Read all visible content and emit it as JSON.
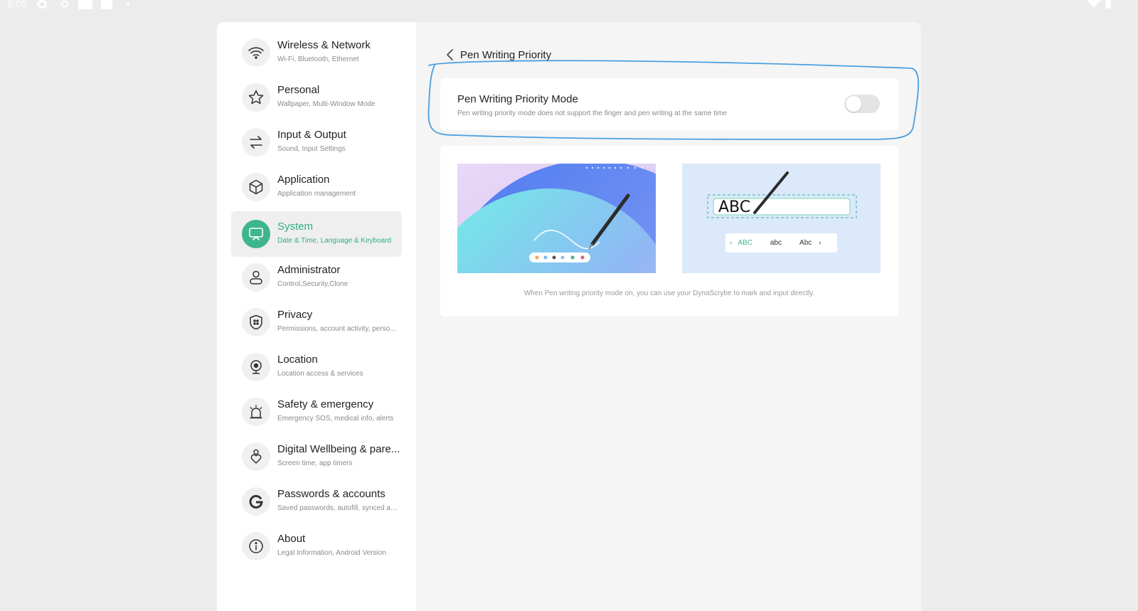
{
  "status_bar": {
    "time": "8:05"
  },
  "sidebar": {
    "items": [
      {
        "title": "Wireless & Network",
        "subtitle": "Wi-Fi, Bluetooth, Ethernet",
        "icon": "wifi-icon"
      },
      {
        "title": "Personal",
        "subtitle": "Wallpaper, Multi-Window Mode",
        "icon": "star-icon"
      },
      {
        "title": "Input & Output",
        "subtitle": "Sound, Input Settings",
        "icon": "swap-arrows-icon"
      },
      {
        "title": "Application",
        "subtitle": "Application management",
        "icon": "cube-icon"
      },
      {
        "title": "System",
        "subtitle": "Date & Time, Language & Keyboard",
        "icon": "presentation-screen-icon",
        "active": true
      },
      {
        "title": "Administrator",
        "subtitle": "Control,Security,Clone",
        "icon": "person-icon"
      },
      {
        "title": "Privacy",
        "subtitle": "Permissions, account activity, perso...",
        "icon": "shield-icon"
      },
      {
        "title": "Location",
        "subtitle": "Location access & services",
        "icon": "location-pin-icon"
      },
      {
        "title": "Safety & emergency",
        "subtitle": "Emergency SOS, medical info, alerts",
        "icon": "alarm-light-icon"
      },
      {
        "title": "Digital Wellbeing & pare...",
        "subtitle": "Screen time, app timers",
        "icon": "heart-person-icon"
      },
      {
        "title": "Passwords & accounts",
        "subtitle": "Saved passwords, autofill, synced ac...",
        "icon": "google-g-icon"
      },
      {
        "title": "About",
        "subtitle": "Legal Information, Android Version",
        "icon": "info-icon"
      }
    ],
    "accent_color": "#3fb58f"
  },
  "main": {
    "page_title": "Pen Writing Priority",
    "setting": {
      "title": "Pen Writing Priority Mode",
      "description": "Pen writing priority mode does not support the finger and pen writing at the same time",
      "enabled": false
    },
    "illustration_right": {
      "handwriting": "ABC",
      "candidates": [
        "ABC",
        "abc",
        "Abc"
      ]
    },
    "caption": "When Pen writing priority mode on, you can use your DynaScrybe to mark and input directly."
  },
  "annotation_color": "#4a9fe0"
}
